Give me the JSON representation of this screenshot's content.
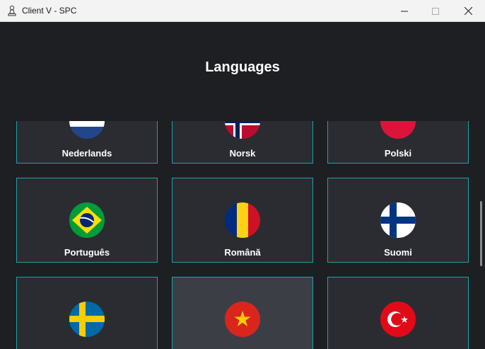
{
  "window": {
    "title": "Client V - SPC",
    "minimize_icon": "minimize-icon",
    "maximize_icon": "maximize-icon",
    "close_icon": "close-icon"
  },
  "header": {
    "title": "Languages"
  },
  "languages": [
    {
      "label": "Nederlands",
      "flag_icon": "netherlands-flag-icon"
    },
    {
      "label": "Norsk",
      "flag_icon": "norway-flag-icon"
    },
    {
      "label": "Polski",
      "flag_icon": "poland-flag-icon"
    },
    {
      "label": "Português",
      "flag_icon": "brazil-flag-icon"
    },
    {
      "label": "Română",
      "flag_icon": "romania-flag-icon"
    },
    {
      "label": "Suomi",
      "flag_icon": "finland-flag-icon"
    },
    {
      "label": "",
      "flag_icon": "sweden-flag-icon"
    },
    {
      "label": "",
      "flag_icon": "vietnam-flag-icon"
    },
    {
      "label": "",
      "flag_icon": "turkey-flag-icon"
    }
  ],
  "colors": {
    "background": "#1e1f23",
    "tile": "#2b2c31",
    "tile_hover": "#3c3e45",
    "tile_border": "#1aa3a8"
  }
}
